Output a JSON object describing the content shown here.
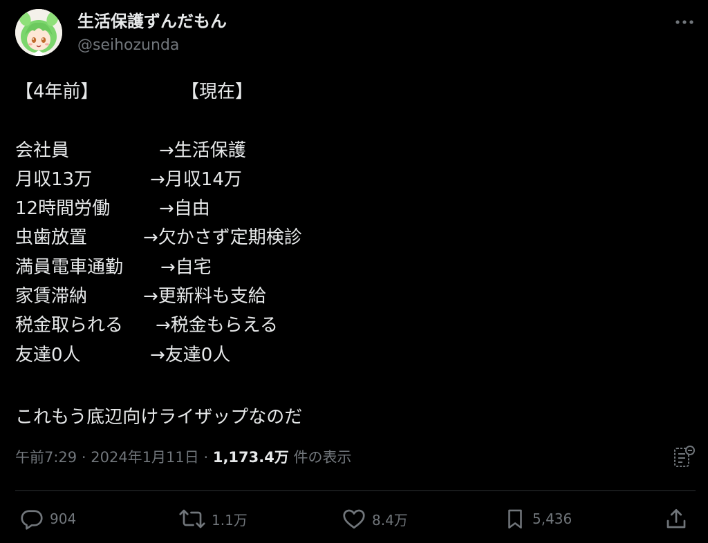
{
  "author": {
    "display_name": "生活保護ずんだもん",
    "handle": "@seihozunda"
  },
  "post": {
    "header_left": "【4年前】",
    "header_right": "【現在】",
    "rows": [
      {
        "before": "会社員",
        "after": "→生活保護"
      },
      {
        "before": "月収13万",
        "after": "→月収14万"
      },
      {
        "before": "12時間労働",
        "after": "→自由"
      },
      {
        "before": "虫歯放置",
        "after": "→欠かさず定期検診"
      },
      {
        "before": "満員電車通勤",
        "after": "→自宅"
      },
      {
        "before": "家賃滞納",
        "after": "→更新料も支給"
      },
      {
        "before": "税金取られる",
        "after": "→税金もらえる"
      },
      {
        "before": "友達0人",
        "after": "→友達0人"
      }
    ],
    "closing": "これもう底辺向けライザップなのだ"
  },
  "meta": {
    "time": "午前7:29",
    "separator": "·",
    "date": "2024年1月11日",
    "views_count": "1,173.4万",
    "views_label": "件の表示"
  },
  "actions": {
    "replies": "904",
    "reposts": "1.1万",
    "likes": "8.4万",
    "bookmarks": "5,436"
  },
  "icons": {
    "more": "more-horizontal-icon",
    "analytics": "analytics-icon",
    "reply": "reply-icon",
    "repost": "repost-icon",
    "like": "heart-icon",
    "bookmark": "bookmark-icon",
    "share": "share-icon"
  },
  "colors": {
    "background": "#000000",
    "text": "#e7e9ea",
    "secondary": "#71767b",
    "divider": "#2f3336",
    "avatar_hair": "#7cd66d"
  }
}
